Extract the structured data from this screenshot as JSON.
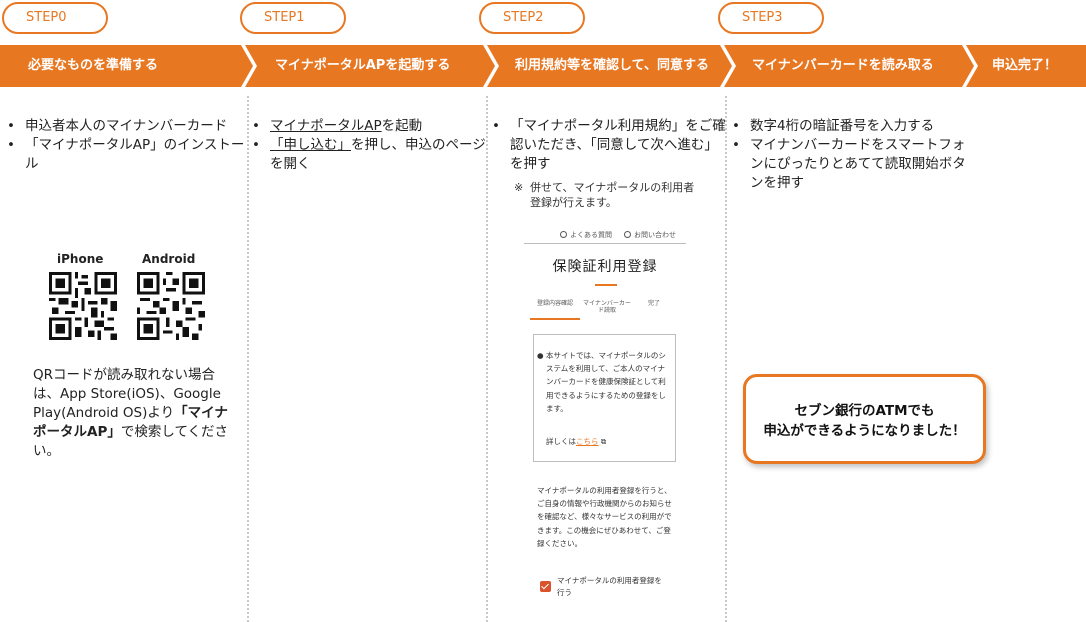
{
  "steps": [
    {
      "pill": "STEP0",
      "title": "必要なものを準備する"
    },
    {
      "pill": "STEP1",
      "title": "マイナポータルAPを起動する"
    },
    {
      "pill": "STEP2",
      "title": "利用規約等を確認して、同意する"
    },
    {
      "pill": "STEP3",
      "title": "マイナンバーカードを読み取る"
    },
    {
      "pill": "",
      "title": "申込完了！"
    }
  ],
  "step0": {
    "bullets": [
      "申込者本人のマイナンバーカード",
      "「マイナポータルAP」のインストール"
    ],
    "qr_labels": [
      "iPhone",
      "Android"
    ],
    "qr_text_1": "QRコードが読み取れない場合は、App Store(iOS)、Google Play(Android OS)より",
    "qr_text_bold": "「マイナポータルAP」",
    "qr_text_2": "で検索してください。"
  },
  "step1": {
    "bullet1_link": "マイナポータルAP",
    "bullet1_rest": "を起動",
    "bullet2_link": "「申し込む」",
    "bullet2_rest": "を押し、申込のページを開く"
  },
  "step2": {
    "bullet": "「マイナポータル利用規約」をご確認いただき、「同意して次へ進む」を押す",
    "note_mark": "※",
    "note": "併せて、マイナポータルの利用者登録が行えます。",
    "mock": {
      "link_faq": "よくある質問",
      "link_contact": "お問い合わせ",
      "title": "保険証利用登録",
      "tabs": [
        "登録内容確認",
        "マイナンバーカード読取",
        "完了"
      ],
      "box_text": "本サイトでは、マイナポータルのシステムを利用して、ご本人のマイナンバーカードを健康保険証として利用できるようにするための登録をします。",
      "detail_prefix": "詳しくは",
      "detail_link": "こちら",
      "para": "マイナポータルの利用者登録を行うと、ご自身の情報や行政機関からのお知らせを確認など、様々なサービスの利用ができます。この機会にぜひあわせて、ご登録ください。",
      "checkbox_label": "マイナポータルの利用者登録を行う"
    }
  },
  "step3": {
    "bullets": [
      "数字4桁の暗証番号を入力する",
      "マイナンバーカードをスマートフォンにぴったりとあてて読取開始ボタンを押す"
    ]
  },
  "callout": {
    "line1": "セブン銀行のATMでも",
    "line2": "申込ができるようになりました！"
  },
  "colors": {
    "accent": "#e87722",
    "checkbox": "#d9532c"
  }
}
